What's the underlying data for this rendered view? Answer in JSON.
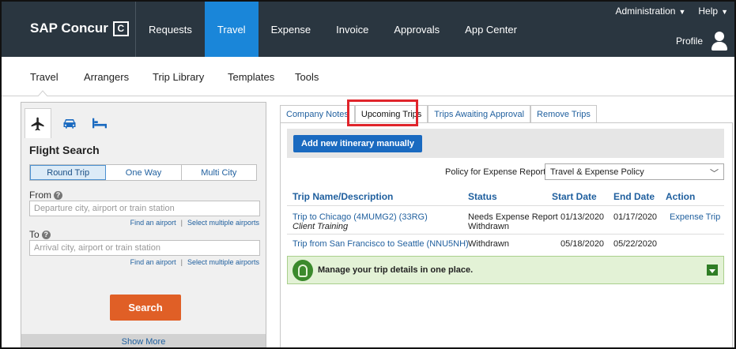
{
  "header": {
    "logo_text": "SAP Concur",
    "logo_mark": "C",
    "nav": [
      "Requests",
      "Travel",
      "Expense",
      "Invoice",
      "Approvals",
      "App Center"
    ],
    "active_nav": "Travel",
    "administration": "Administration",
    "help": "Help",
    "profile": "Profile"
  },
  "subnav": {
    "items": [
      "Travel",
      "Arrangers",
      "Trip Library",
      "Templates",
      "Tools"
    ],
    "active": "Travel"
  },
  "flight_search": {
    "title": "Flight Search",
    "mode_icons": [
      "airplane-icon",
      "car-icon",
      "bed-icon"
    ],
    "trip_types": [
      "Round Trip",
      "One Way",
      "Multi City"
    ],
    "selected_trip_type": "Round Trip",
    "from": {
      "label": "From",
      "placeholder": "Departure city, airport or train station",
      "value": ""
    },
    "to": {
      "label": "To",
      "placeholder": "Arrival city, airport or train station",
      "value": ""
    },
    "find_airport": "Find an airport",
    "select_multiple": "Select multiple airports",
    "search_button": "Search",
    "show_more": "Show More"
  },
  "trips": {
    "tabs": [
      "Company Notes",
      "Upcoming Trips",
      "Trips Awaiting Approval",
      "Remove Trips"
    ],
    "active_tab": "Upcoming Trips",
    "add_button": "Add new itinerary manually",
    "policy_label": "Policy for Expense Reports",
    "policy_value": "Travel & Expense Policy",
    "columns": [
      "Trip Name/Description",
      "Status",
      "Start Date",
      "End Date",
      "Action"
    ],
    "rows": [
      {
        "name": "Trip to Chicago (4MUMG2) (33RG)",
        "description": "Client Training",
        "status": "Needs Expense Report",
        "status2": "Withdrawn",
        "start": "01/13/2020",
        "end": "01/17/2020",
        "action": "Expense Trip"
      },
      {
        "name": "Trip from San Francisco to Seattle (NNU5NH)",
        "description": "",
        "status": "Withdrawn",
        "status2": "",
        "start": "05/18/2020",
        "end": "05/22/2020",
        "action": ""
      }
    ],
    "banner_text": "Manage your trip details in one place."
  },
  "colors": {
    "topbar": "#2a3640",
    "active_nav": "#1a86d9",
    "link": "#1f5f9e",
    "search_button": "#e05f26",
    "highlight": "#e0242b",
    "banner_bg": "#e3f2d6"
  }
}
